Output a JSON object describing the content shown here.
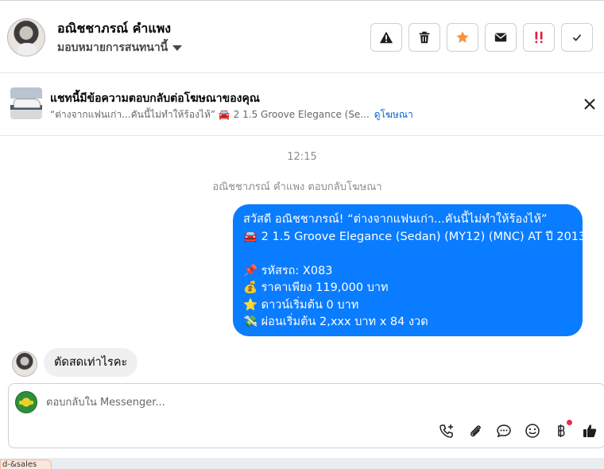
{
  "header": {
    "contact_name": "อณิชชาภรณ์ คำแพง",
    "assign_label": "มอบหมายการสนทนานี้",
    "actions": [
      {
        "name": "warning",
        "icon": "warning-icon"
      },
      {
        "name": "delete",
        "icon": "trash-icon"
      },
      {
        "name": "star",
        "icon": "star-icon",
        "color": "#f7923b"
      },
      {
        "name": "mark-unread",
        "icon": "envelope-icon"
      },
      {
        "name": "spam",
        "icon": "double-exclamation-icon",
        "color": "#e41e3f"
      },
      {
        "name": "done",
        "icon": "check-icon"
      }
    ]
  },
  "ad_banner": {
    "title": "แชทนี้มีข้อความตอบกลับต่อโฆษณาของคุณ",
    "snippet": "“ต่างจากแฟนเก่า...คันนี้ไม่ทำให้ร้องไห้” 🚘 2 1.5 Groove Elegance (Se...",
    "link_label": "ดูโฆษณา"
  },
  "chat": {
    "timestamp": "12:15",
    "system_note": "อณิชชาภรณ์ คำแพง ตอบกลับโฆษณา",
    "outgoing_lines": [
      "สวัสดี อณิชชาภรณ์! “ต่างจากแฟนเก่า...คันนี้ไม่ทำให้ร้องไห้”",
      "🚘 2 1.5 Groove Elegance (Sedan) (MY12) (MNC) AT ปี 2013",
      "",
      "📌 รหัสรถ: X083",
      "💰 ราคาเพียง 119,000 บาท",
      "⭐ ดาวน์เริ่มต้น 0 บาท",
      "💸 ผ่อนเริ่มต้น 2,xxx บาท x 84 งวด"
    ],
    "incoming_message": "ตัดสดเท่าไรคะ"
  },
  "composer": {
    "placeholder": "ตอบกลับใน Messenger...",
    "tools": [
      "phone-add-icon",
      "paperclip-icon",
      "chat-bubble-icon",
      "emoji-icon",
      "baht-icon",
      "thumbs-up-icon"
    ]
  },
  "bottom_tab": {
    "label": "d-&sales"
  },
  "colors": {
    "accent": "#0a7cff",
    "link": "#0064d1",
    "incoming_bubble": "#f0f0f0"
  }
}
